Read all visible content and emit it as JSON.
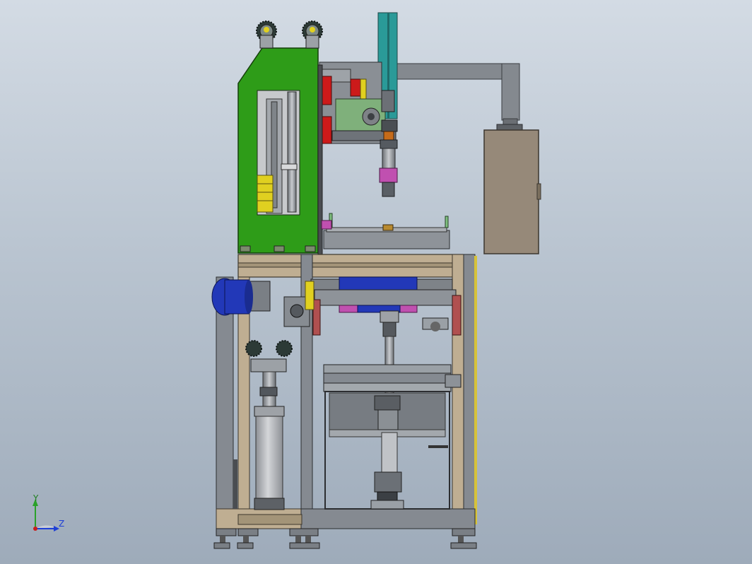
{
  "triad": {
    "y_label": "Y",
    "z_label": "Z",
    "y_color": "#2aa12a",
    "z_color": "#1f3fd6",
    "x_color": "#c81e1e"
  },
  "colors": {
    "background_top": "#d3dbe4",
    "background_bottom": "#9eabba",
    "frame_steel": "#858a91",
    "frame_wood": "#bfae92",
    "green_panel": "#2e9c18",
    "teal_arm": "#2a9a98",
    "control_box": "#968979",
    "motor_blue": "#2238b8",
    "cylinder_gray": "#b3b6ba",
    "red_pad": "#cc1a1a",
    "yellow_part": "#e0d020",
    "magenta_part": "#c050b0"
  }
}
